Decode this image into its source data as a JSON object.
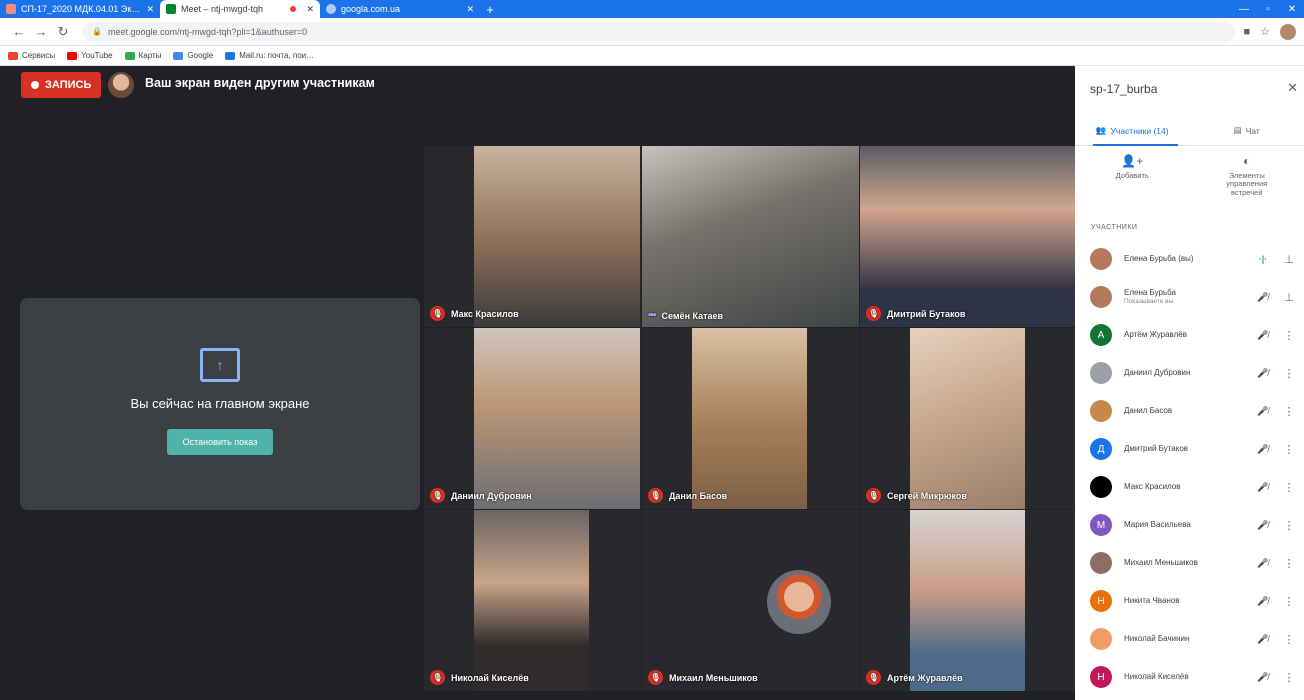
{
  "browser": {
    "tabs": [
      {
        "title": "СП-17_2020 МДК.04.01 Эконо…",
        "active": false,
        "favicon_color": "#f28b82"
      },
      {
        "title": "Meet – ntj-mwgd-tqh",
        "active": true,
        "favicon_color": "#00832d"
      },
      {
        "title": "googla.com.ua",
        "active": false,
        "favicon_color": "#aecbfa"
      }
    ],
    "new_tab": "+",
    "url": "meet.google.com/ntj-mwgd-tqh?pli=1&authuser=0",
    "bookmarks": [
      {
        "label": "Сервисы",
        "color": "#ea4335"
      },
      {
        "label": "YouTube",
        "color": "#ff0000"
      },
      {
        "label": "Карты",
        "color": "#34a853"
      },
      {
        "label": "Google",
        "color": "#4285f4"
      },
      {
        "label": "Mail.ru: почта, пои…",
        "color": "#1a73e8"
      }
    ]
  },
  "meeting": {
    "recording_label": "ЗАПИСЬ",
    "presenting_banner": "Ваш экран виден другим участникам",
    "presenting_card_title": "Вы сейчас на главном экране",
    "stop_button": "Остановить показ"
  },
  "tiles": [
    {
      "name": "Макс Красилов",
      "status": "muted",
      "bg": "#8a6d57"
    },
    {
      "name": "Семён Катаев",
      "status": "speaking",
      "bg": "#5d5a57"
    },
    {
      "name": "Дмитрий Бутаков",
      "status": "muted",
      "bg": "#3e3f4a"
    },
    {
      "name": "Даниил Дубровин",
      "status": "muted",
      "bg": "#7b7a7c"
    },
    {
      "name": "Данил Басов",
      "status": "muted",
      "bg": "#a9825e"
    },
    {
      "name": "Сергей Микрюков",
      "status": "muted",
      "bg": "#c9a98d"
    },
    {
      "name": "Николай Киселёв",
      "status": "muted",
      "bg": "#4a4440"
    },
    {
      "name": "Михаил Меньшиков",
      "status": "muted",
      "bg": "#28292c"
    },
    {
      "name": "Артём Журавлёв",
      "status": "muted",
      "bg": "#6f6a66"
    }
  ],
  "panel": {
    "meeting_name": "sp-17_burba",
    "participants_tab": "Участники (14)",
    "chat_tab": "Чат",
    "add_label": "Добавить",
    "controls_label": "Элементы управления встречей",
    "section_label": "УЧАСТНИКИ",
    "participants": [
      {
        "name": "Елена Бурьба (вы)",
        "sub": "",
        "avatar": "photo",
        "color": "#b47a5d",
        "mic": "speaking",
        "action": "pin"
      },
      {
        "name": "Елена Бурьба",
        "sub": "Показываете вы",
        "avatar": "photo",
        "color": "#b47a5d",
        "mic": "muted-outline",
        "action": "pin"
      },
      {
        "name": "Артём Журавлёв",
        "sub": "",
        "avatar": "А",
        "color": "#137333",
        "mic": "muted",
        "action": "more"
      },
      {
        "name": "Даниил Дубровин",
        "sub": "",
        "avatar": "photo",
        "color": "#9aa0a6",
        "mic": "muted",
        "action": "more"
      },
      {
        "name": "Данил Басов",
        "sub": "",
        "avatar": "photo",
        "color": "#c58a4a",
        "mic": "muted",
        "action": "more"
      },
      {
        "name": "Дмитрий Бутаков",
        "sub": "",
        "avatar": "Д",
        "color": "#1a73e8",
        "mic": "muted",
        "action": "more"
      },
      {
        "name": "Макс Красилов",
        "sub": "",
        "avatar": "",
        "color": "#000000",
        "mic": "muted",
        "action": "more"
      },
      {
        "name": "Мария Васильева",
        "sub": "",
        "avatar": "М",
        "color": "#7e57c2",
        "mic": "muted",
        "action": "more"
      },
      {
        "name": "Михаил Меньшиков",
        "sub": "",
        "avatar": "photo",
        "color": "#8d6e63",
        "mic": "muted",
        "action": "more"
      },
      {
        "name": "Никита Чванов",
        "sub": "",
        "avatar": "Н",
        "color": "#e8710a",
        "mic": "muted",
        "action": "more"
      },
      {
        "name": "Николай Бачинин",
        "sub": "",
        "avatar": "photo",
        "color": "#f29c65",
        "mic": "muted",
        "action": "more"
      },
      {
        "name": "Николай Киселёв",
        "sub": "",
        "avatar": "Н",
        "color": "#c2185b",
        "mic": "muted",
        "action": "more"
      }
    ]
  }
}
